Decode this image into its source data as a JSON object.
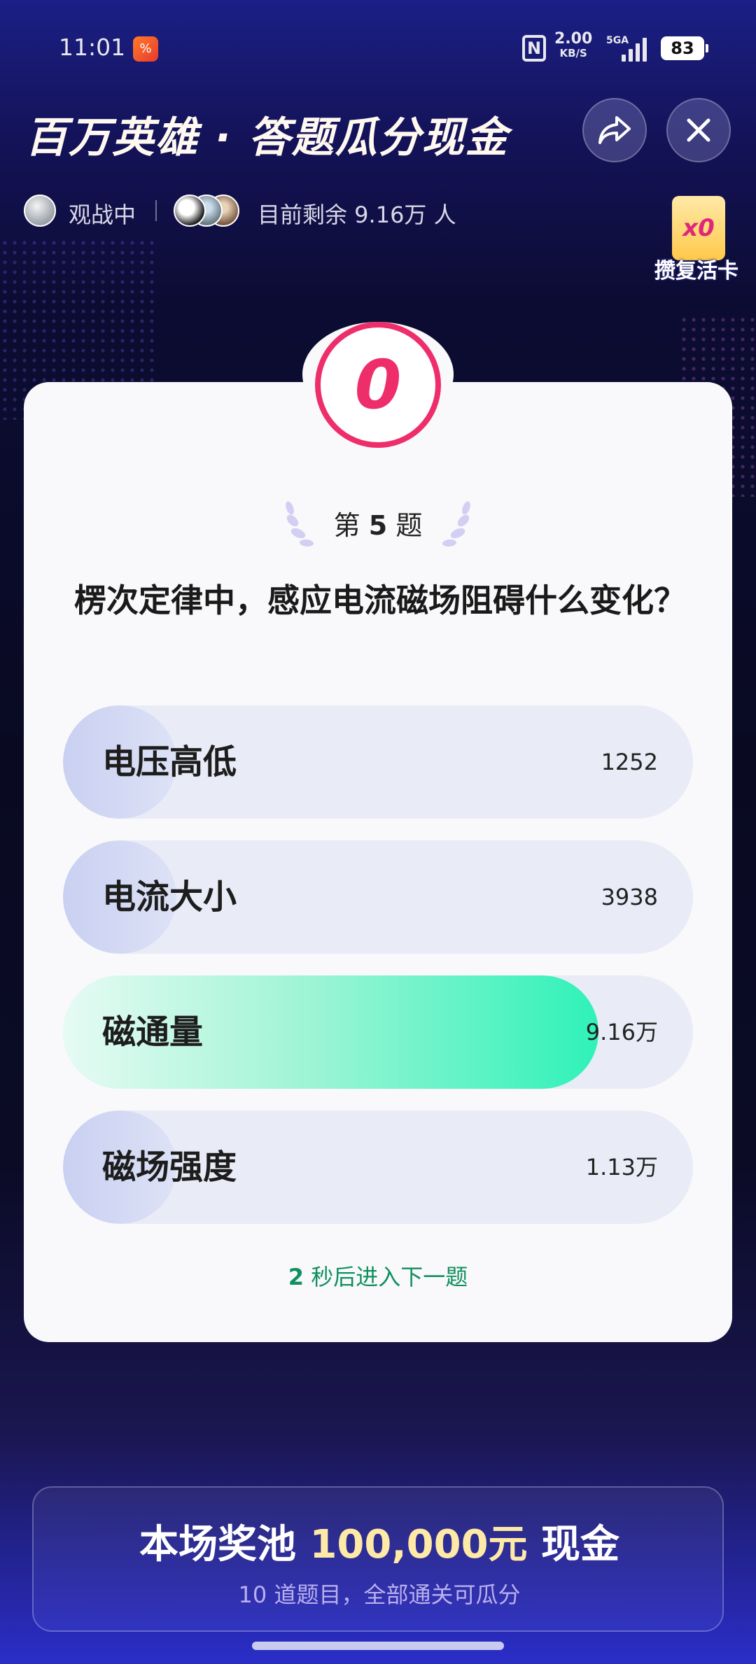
{
  "status_bar": {
    "time": "11:01",
    "net_speed": "2.00",
    "net_unit": "KB/S",
    "signal_type": "5GA",
    "battery": "83"
  },
  "header": {
    "title": "百万英雄 · 答题瓜分现金",
    "watching": "观战中",
    "remaining": "目前剩余 9.16万 人"
  },
  "revive_card": {
    "count": "x0",
    "label": "攒复活卡"
  },
  "timer": "0",
  "question": {
    "number_prefix": "第",
    "number": "5",
    "number_suffix": "题",
    "text": "楞次定律中，感应电流磁场阻碍什么变化？",
    "options": [
      {
        "label": "电压高低",
        "count": "1252",
        "share": 0.18,
        "correct": false
      },
      {
        "label": "电流大小",
        "count": "3938",
        "share": 0.18,
        "correct": false
      },
      {
        "label": "磁通量",
        "count": "9.16万",
        "share": 0.85,
        "correct": true
      },
      {
        "label": "磁场强度",
        "count": "1.13万",
        "share": 0.18,
        "correct": false
      }
    ],
    "next_seconds": "2",
    "next_text": "秒后进入下一题"
  },
  "prize": {
    "prefix": "本场奖池",
    "amount": "100,000元",
    "suffix": "现金",
    "subtitle": "10 道题目，全部通关可瓜分"
  },
  "colors": {
    "timer": "#ee2e6b",
    "correct_fill": "#2ff2b8",
    "next_hint": "#10905e",
    "prize_amount": "#ffe9a6"
  },
  "icons": [
    "share-icon",
    "close-icon",
    "laurel-left-icon",
    "laurel-right-icon"
  ]
}
